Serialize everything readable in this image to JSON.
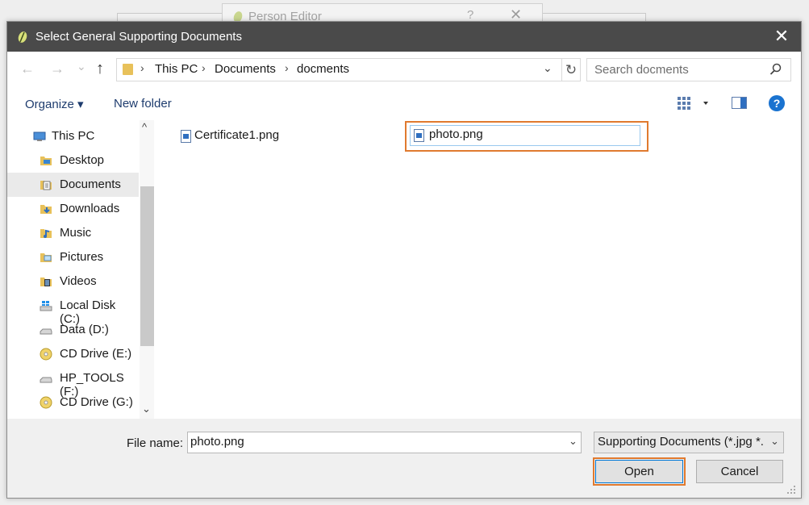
{
  "background_window": {
    "title": "Person Editor",
    "help": "?",
    "close": "✕"
  },
  "dialog": {
    "title": "Select General Supporting Documents",
    "close": "✕"
  },
  "address_bar": {
    "back": "←",
    "forward": "→",
    "recent": "⌄",
    "up": "↑",
    "crumbs": [
      "This PC",
      "Documents",
      "docments"
    ],
    "separator": "›",
    "dropdown": "⌄",
    "refresh": "↻"
  },
  "search": {
    "placeholder": "Search docments"
  },
  "toolbar": {
    "organize": "Organize ▾",
    "new_folder": "New folder",
    "help": "?"
  },
  "nav": {
    "items": [
      {
        "label": "This PC",
        "icon": "pc-icon"
      },
      {
        "label": "Desktop",
        "icon": "desktop-folder-icon"
      },
      {
        "label": "Documents",
        "icon": "documents-folder-icon",
        "selected": true
      },
      {
        "label": "Downloads",
        "icon": "downloads-folder-icon"
      },
      {
        "label": "Music",
        "icon": "music-folder-icon"
      },
      {
        "label": "Pictures",
        "icon": "pictures-folder-icon"
      },
      {
        "label": "Videos",
        "icon": "videos-folder-icon"
      },
      {
        "label": "Local Disk (C:)",
        "icon": "windows-drive-icon"
      },
      {
        "label": "Data (D:)",
        "icon": "drive-icon"
      },
      {
        "label": "CD Drive (E:)",
        "icon": "cd-drive-icon"
      },
      {
        "label": "HP_TOOLS (F:)",
        "icon": "drive-icon"
      },
      {
        "label": "CD Drive (G:)",
        "icon": "cd-drive-icon"
      }
    ],
    "scroll_up": "^",
    "scroll_down": "⌄"
  },
  "files": [
    {
      "name": "Certificate1.png",
      "selected": false
    },
    {
      "name": "photo.png",
      "selected": true
    }
  ],
  "bottom": {
    "file_name_label": "File name:",
    "file_name_value": "photo.png",
    "file_name_dropdown": "⌄",
    "file_type": "Supporting Documents (*.jpg *.",
    "file_type_dropdown": "⌄",
    "open": "Open",
    "cancel": "Cancel"
  },
  "colors": {
    "titlebar": "#4a4a4a",
    "highlight": "#e07a2f",
    "accent": "#1a73d0"
  }
}
